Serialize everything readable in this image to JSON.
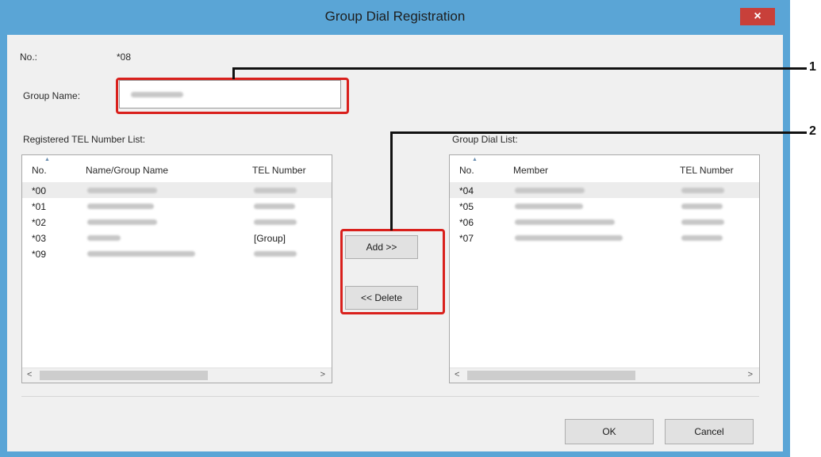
{
  "window": {
    "title": "Group Dial Registration",
    "close_glyph": "×"
  },
  "fields": {
    "no_label": "No.:",
    "no_value": "*08",
    "group_name_label": "Group Name:",
    "group_name_value": ""
  },
  "registered_list": {
    "label": "Registered TEL Number List:",
    "columns": [
      "No.",
      "Name/Group Name",
      "TEL Number"
    ],
    "rows": [
      {
        "no": "*00",
        "tel": ""
      },
      {
        "no": "*01",
        "tel": ""
      },
      {
        "no": "*02",
        "tel": ""
      },
      {
        "no": "*03",
        "tel": "[Group]"
      },
      {
        "no": "*09",
        "tel": ""
      }
    ],
    "scroll_left": "<",
    "scroll_right": ">"
  },
  "group_list": {
    "label": "Group Dial List:",
    "columns": [
      "No.",
      "Member",
      "TEL Number"
    ],
    "rows": [
      {
        "no": "*04"
      },
      {
        "no": "*05"
      },
      {
        "no": "*06"
      },
      {
        "no": "*07"
      }
    ],
    "scroll_left": "<",
    "scroll_right": ">"
  },
  "buttons": {
    "add": "Add >>",
    "delete": "<< Delete",
    "ok": "OK",
    "cancel": "Cancel"
  },
  "callouts": [
    "1",
    "2"
  ],
  "colors": {
    "titlebar": "#5aa5d6",
    "close": "#c8403a",
    "highlight": "#d9201c"
  }
}
